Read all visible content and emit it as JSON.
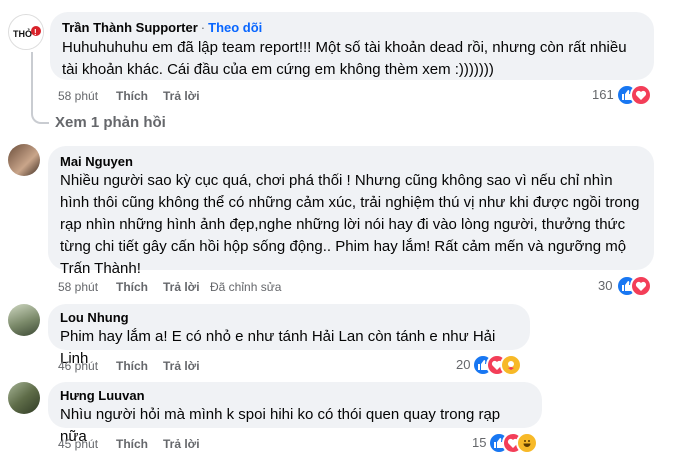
{
  "comments": [
    {
      "author": "Trần Thành Supporter",
      "follow": "Theo dõi",
      "text": "Huhuhuhuhu em đã lập team report!!! Một số tài khoản dead rồi, nhưng còn rất nhiều tài khoản khác. Cái đầu của em cứng em không thèm xem :)))))))",
      "time": "58 phút",
      "like": "Thích",
      "reply": "Trả lời",
      "reactions": "161",
      "reaction_icons": [
        "like-icon",
        "love-icon"
      ],
      "view_replies": "Xem 1 phản hồi"
    },
    {
      "author": "Mai Nguyen",
      "text": "Nhiều người sao kỳ cục quá, chơi phá thối ! Nhưng cũng không sao vì nếu chỉ nhìn hình thôi cũng không thể có những cảm xúc, trải nghiệm thú vị như khi được ngồi trong rạp nhìn những hình ảnh đẹp,nghe những lời nói hay đi vào lòng người, thưởng thức từng chi tiết gây cấn hồi hộp sống động.. Phim hay lắm! Rất cảm mến và ngưỡng mộ Trấn Thành!",
      "time": "58 phút",
      "like": "Thích",
      "reply": "Trả lời",
      "edited": "Đã chỉnh sửa",
      "reactions": "30",
      "reaction_icons": [
        "like-icon",
        "love-icon"
      ]
    },
    {
      "author": "Lou Nhung",
      "text": "Phim hay lắm a! E có nhỏ e như tánh Hải Lan còn tánh e như Hải Linh",
      "time": "46 phút",
      "like": "Thích",
      "reply": "Trả lời",
      "reactions": "20",
      "reaction_icons": [
        "like-icon",
        "love-icon",
        "care-icon"
      ]
    },
    {
      "author": "Hưng Luuvan",
      "text": "Nhìu người hỏi mà mình k spoi hihi ko có thói quen quay trong rạp nữa",
      "time": "45 phút",
      "like": "Thích",
      "reply": "Trả lời",
      "reactions": "15",
      "reaction_icons": [
        "like-icon",
        "love-icon",
        "haha-icon"
      ]
    }
  ],
  "colors": {
    "bubble": "#f0f2f5",
    "meta": "#65676b",
    "accent": "#0866ff",
    "like": "#1877f2",
    "love": "#f33e58"
  }
}
